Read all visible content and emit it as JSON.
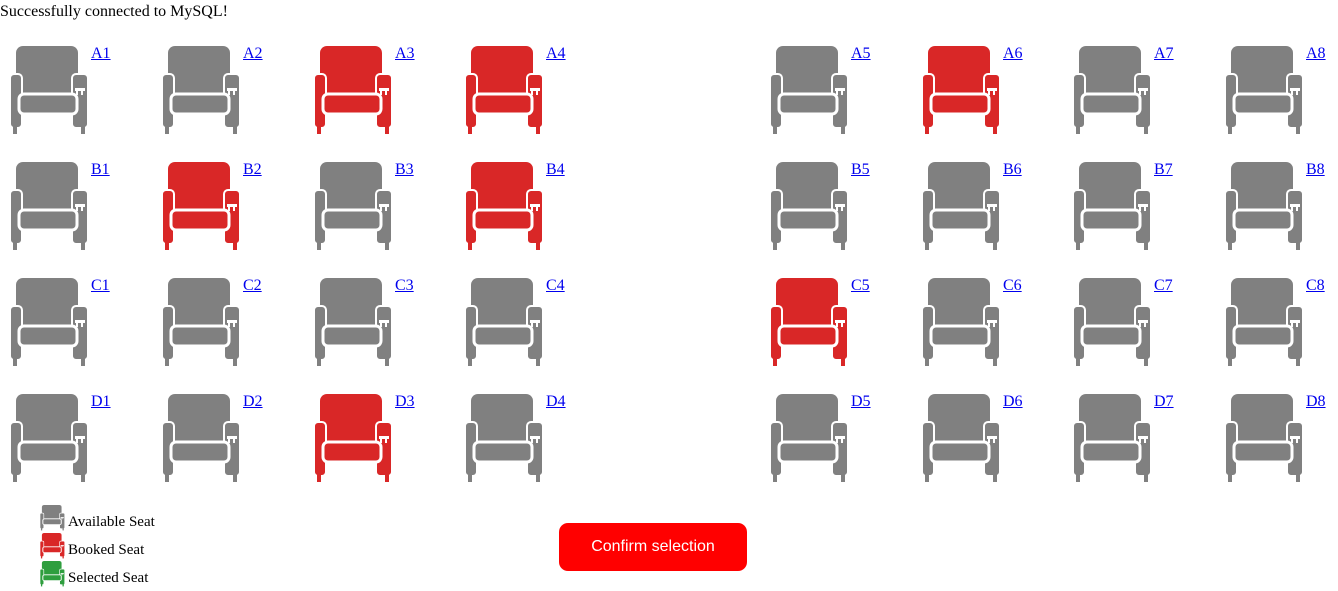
{
  "status_message": "Successfully connected to MySQL!",
  "colors": {
    "available": "#808080",
    "booked": "#d92727",
    "selected": "#2e9e3e",
    "confirm_button": "#ff0000",
    "link": "#0000ee"
  },
  "seat_icon": "armchair-icon",
  "seats": [
    {
      "id": "A1",
      "status": "available"
    },
    {
      "id": "A2",
      "status": "available"
    },
    {
      "id": "A3",
      "status": "booked"
    },
    {
      "id": "A4",
      "status": "booked"
    },
    {
      "id": "A5",
      "status": "available"
    },
    {
      "id": "A6",
      "status": "booked"
    },
    {
      "id": "A7",
      "status": "available"
    },
    {
      "id": "A8",
      "status": "available"
    },
    {
      "id": "B1",
      "status": "available"
    },
    {
      "id": "B2",
      "status": "booked"
    },
    {
      "id": "B3",
      "status": "available"
    },
    {
      "id": "B4",
      "status": "booked"
    },
    {
      "id": "B5",
      "status": "available"
    },
    {
      "id": "B6",
      "status": "available"
    },
    {
      "id": "B7",
      "status": "available"
    },
    {
      "id": "B8",
      "status": "available"
    },
    {
      "id": "C1",
      "status": "available"
    },
    {
      "id": "C2",
      "status": "available"
    },
    {
      "id": "C3",
      "status": "available"
    },
    {
      "id": "C4",
      "status": "available"
    },
    {
      "id": "C5",
      "status": "booked"
    },
    {
      "id": "C6",
      "status": "available"
    },
    {
      "id": "C7",
      "status": "available"
    },
    {
      "id": "C8",
      "status": "available"
    },
    {
      "id": "D1",
      "status": "available"
    },
    {
      "id": "D2",
      "status": "available"
    },
    {
      "id": "D3",
      "status": "booked"
    },
    {
      "id": "D4",
      "status": "available"
    },
    {
      "id": "D5",
      "status": "available"
    },
    {
      "id": "D6",
      "status": "available"
    },
    {
      "id": "D7",
      "status": "available"
    },
    {
      "id": "D8",
      "status": "available"
    }
  ],
  "legend": [
    {
      "key": "available",
      "label": "Available Seat"
    },
    {
      "key": "booked",
      "label": "Booked Seat"
    },
    {
      "key": "selected",
      "label": "Selected Seat"
    }
  ],
  "confirm_label": "Confirm selection"
}
